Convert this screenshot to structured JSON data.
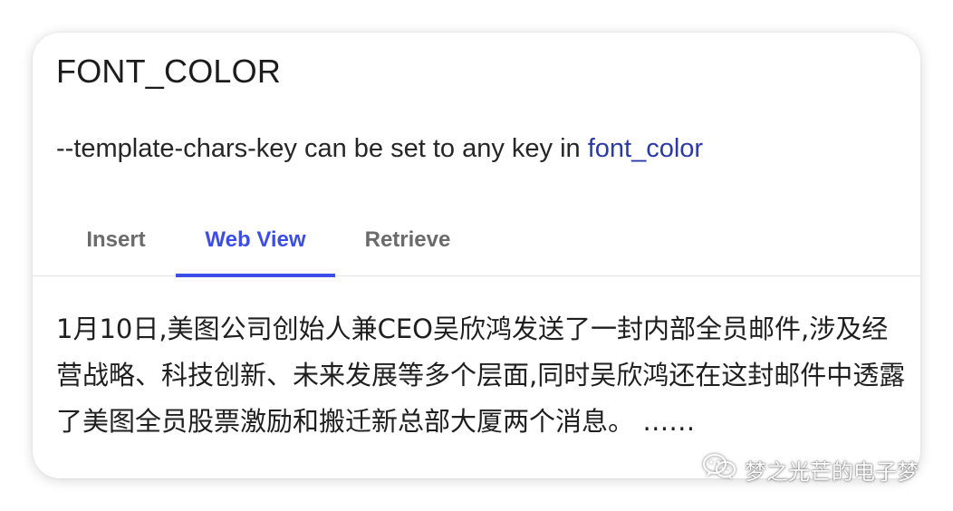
{
  "header": {
    "title": "FONT_COLOR"
  },
  "description": {
    "prefix": "--template-chars-key can be set to any key in ",
    "link": "font_color"
  },
  "tabs": [
    {
      "label": "Insert",
      "active": false
    },
    {
      "label": "Web View",
      "active": true
    },
    {
      "label": "Retrieve",
      "active": false
    }
  ],
  "content": {
    "text": "1月10日,美图公司创始人兼CEO吴欣鸿发送了一封内部全员邮件,涉及经营战略、科技创新、未来发展等多个层面,同时吴欣鸿还在这封邮件中透露了美图全员股票激励和搬迁新总部大厦两个消息。 ……"
  },
  "watermark": {
    "icon": "wechat-icon",
    "text": "梦之光芒的电子梦"
  },
  "colors": {
    "accent": "#3d4ee8",
    "link": "#2b3aa8",
    "tab_inactive": "#6b6b6b",
    "text": "#1f1f1f"
  }
}
